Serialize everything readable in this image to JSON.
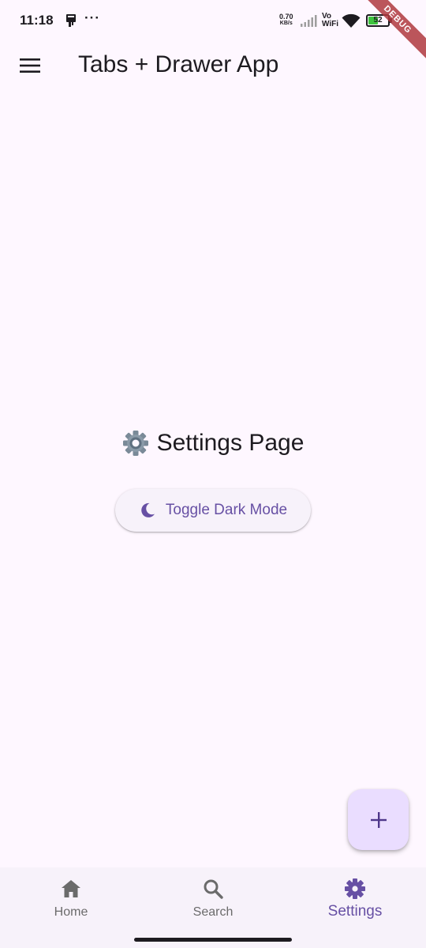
{
  "status_bar": {
    "time": "11:18",
    "more": "···",
    "speed_value": "0.70",
    "speed_unit": "KB/s",
    "vo": "Vo",
    "wifi_label": "WiFi",
    "battery": "52",
    "battery_level": 0.52
  },
  "debug_banner": "DEBUG",
  "app_bar": {
    "title": "Tabs + Drawer App",
    "menu_icon": "menu-icon"
  },
  "main": {
    "heading_emoji": "gear-icon",
    "heading": "Settings Page",
    "toggle_button": {
      "icon": "moon-icon",
      "label": "Toggle Dark Mode"
    }
  },
  "fab": {
    "icon": "plus-icon"
  },
  "bottom_nav": {
    "items": [
      {
        "label": "Home",
        "icon": "home-icon",
        "active": false
      },
      {
        "label": "Search",
        "icon": "search-icon",
        "active": false
      },
      {
        "label": "Settings",
        "icon": "settings-icon",
        "active": true
      }
    ]
  },
  "colors": {
    "background": "#fef7ff",
    "primary": "#6750a4",
    "fab_bg": "#eaddff",
    "nav_bg": "#f7f2fa",
    "inactive": "#6b6b6b",
    "debug": "#b0393f"
  }
}
